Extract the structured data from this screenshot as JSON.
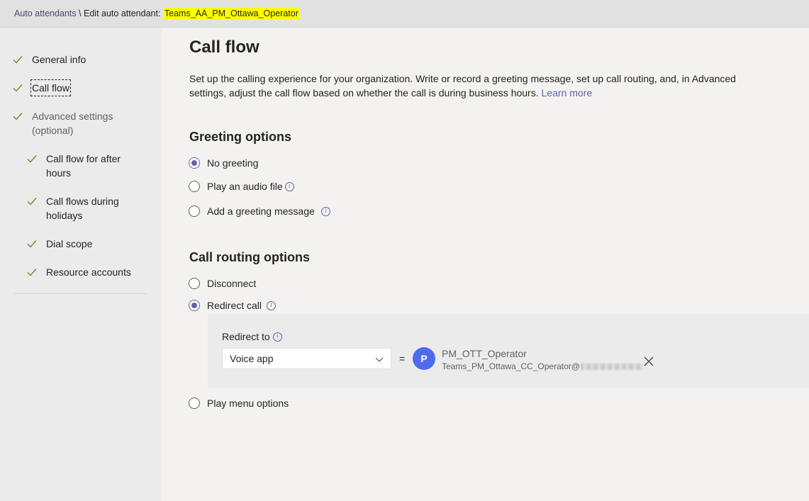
{
  "breadcrumb": {
    "root": "Auto attendants",
    "separator": " \\ ",
    "edit_prefix": "Edit auto attendant: ",
    "name": "Teams_AA_PM_Ottawa_Operator"
  },
  "sidebar": {
    "items": [
      {
        "label": "General info",
        "done": true
      },
      {
        "label": "Call flow",
        "done": true,
        "selected": true
      },
      {
        "label": "Advanced settings",
        "label2": "(optional)",
        "done": true
      },
      {
        "label": "Call flow for after",
        "label2": "hours",
        "done": true
      },
      {
        "label": "Call flows during",
        "label2": "holidays",
        "done": true
      },
      {
        "label": "Dial scope",
        "done": true
      },
      {
        "label": "Resource accounts",
        "done": true
      }
    ]
  },
  "main": {
    "title": "Call flow",
    "description": "Set up the calling experience for your organization. Write or record a greeting message, set up call routing, and, in Advanced settings, adjust the call flow based on whether the call is during business hours. ",
    "learn_more": "Learn more",
    "greeting": {
      "title": "Greeting options",
      "options": [
        {
          "label": "No greeting",
          "selected": true
        },
        {
          "label": "Play an audio file",
          "info": true
        },
        {
          "label": "Add a greeting message",
          "info": true
        }
      ]
    },
    "routing": {
      "title": "Call routing options",
      "options": [
        {
          "label": "Disconnect",
          "selected": false
        },
        {
          "label": "Redirect call",
          "selected": true,
          "info": true
        },
        {
          "label": "Play menu options",
          "selected": false
        }
      ],
      "redirect": {
        "label": "Redirect to",
        "select_value": "Voice app",
        "equals": "=",
        "avatar_initial": "P",
        "target_name": "PM_OTT_Operator",
        "target_email": "Teams_PM_Ottawa_CC_Operator@"
      }
    }
  },
  "icons": {
    "check": "checkmark-icon",
    "info": "info-icon",
    "chevron": "chevron-down-icon",
    "close": "close-icon"
  },
  "colors": {
    "accent": "#6264a7",
    "avatar": "#4f6bed",
    "check": "#6b8e23",
    "highlight": "#ffff00"
  }
}
